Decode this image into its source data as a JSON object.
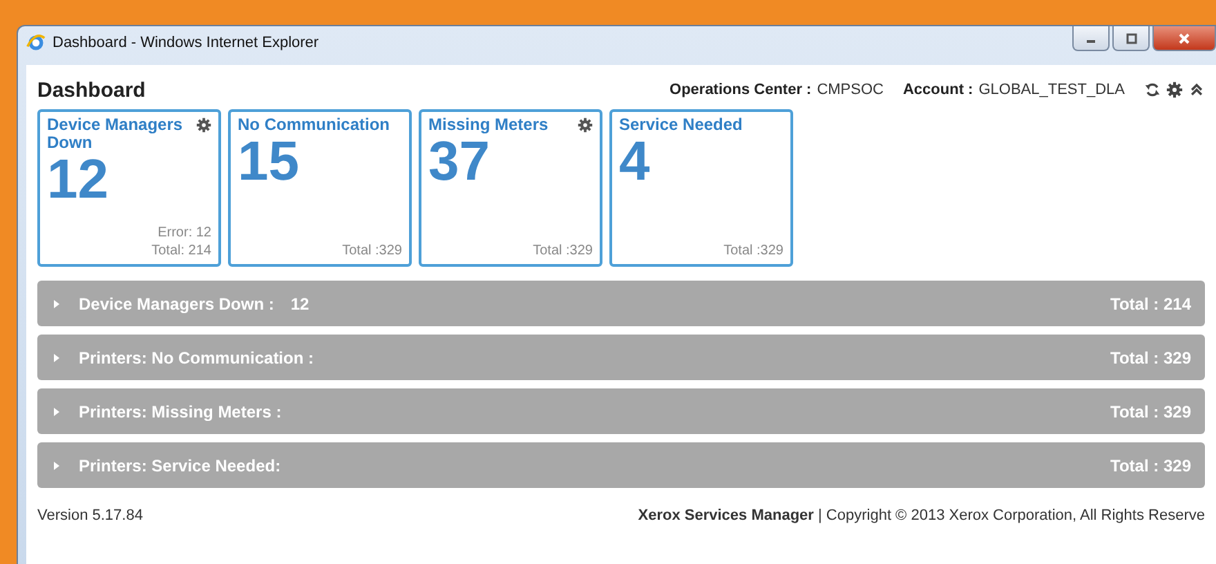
{
  "window": {
    "title": "Dashboard - Windows Internet Explorer"
  },
  "header": {
    "title": "Dashboard",
    "operations_center": {
      "label": "Operations Center :",
      "value": "CMPSOC"
    },
    "account": {
      "label": "Account :",
      "value": "GLOBAL_TEST_DLA"
    }
  },
  "cards": [
    {
      "title": "Device Managers Down",
      "gear": true,
      "count": "12",
      "details": [
        "Error: 12",
        "Total: 214"
      ]
    },
    {
      "title": "No Communication",
      "gear": false,
      "count": "15",
      "details": [
        "Total :329"
      ]
    },
    {
      "title": "Missing Meters",
      "gear": true,
      "count": "37",
      "details": [
        "Total :329"
      ]
    },
    {
      "title": "Service Needed",
      "gear": false,
      "count": "4",
      "details": [
        "Total :329"
      ]
    }
  ],
  "sections": [
    {
      "label": "Device Managers Down :",
      "value": "12",
      "total": "Total : 214",
      "expanded": false
    },
    {
      "label": "Printers: No Communication :",
      "total": "Total : 329",
      "expanded": false
    },
    {
      "label": "Printers: Missing Meters :",
      "total": "Total : 329",
      "expanded": false
    },
    {
      "label": "Printers: Service Needed:",
      "total": "Total : 329",
      "expanded": false
    }
  ],
  "footer": {
    "version": "Version 5.17.84",
    "copyright": "**Xerox Services Manager** | Copyright © 2013 Xerox Corporation, All Rights Reserve"
  }
}
